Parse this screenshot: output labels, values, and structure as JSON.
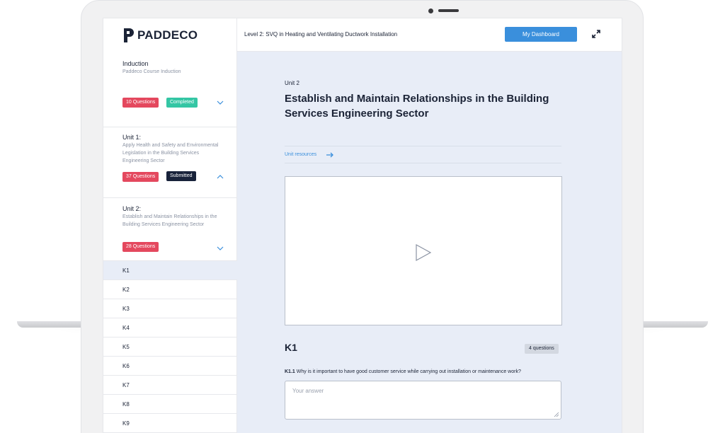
{
  "brand": {
    "name": "PADDECO",
    "color": "#1b2336",
    "accent": "#3a8fdc"
  },
  "header": {
    "course_title": "Level 2: SVQ in Heating and Ventilating Ductwork Installation",
    "dashboard_label": "My Dashboard",
    "expand_icon": "expand-arrows-icon"
  },
  "sidebar": {
    "units": [
      {
        "title": "Induction",
        "subtitle": "Paddeco Course Induction",
        "questions": "10 Questions",
        "status": "Completed",
        "expanded": false
      },
      {
        "title": "Unit 1:",
        "subtitle": "Apply Health and Safety and Environmental Legislation in the Building Services Engineering Sector",
        "questions": "37 Questions",
        "status": "Submitted",
        "expanded": true
      },
      {
        "title": "Unit 2:",
        "subtitle": "Establish and Maintain Relationships in the Building Services Engineering Sector",
        "questions": "28 Questions",
        "expanded": false
      }
    ],
    "items": [
      "K1",
      "K2",
      "K3",
      "K4",
      "K5",
      "K6",
      "K7",
      "K8",
      "K9"
    ],
    "active_item": "K1"
  },
  "main": {
    "unit_label": "Unit 2",
    "heading": "Establish and Maintain Relationships in the Building Services Engineering Sector",
    "resources_link": "Unit resources",
    "section_title": "K1",
    "question_count": "4 questions",
    "question_number": "K1.1",
    "question_text": "Why is it important to have good customer service while carrying out installation or maintenance work?",
    "answer_placeholder": "Your answer"
  },
  "colors": {
    "tag_questions": "#e4485e",
    "tag_completed": "#34c6a4",
    "tag_submitted": "#18223a",
    "content_bg": "#e8edf7"
  }
}
